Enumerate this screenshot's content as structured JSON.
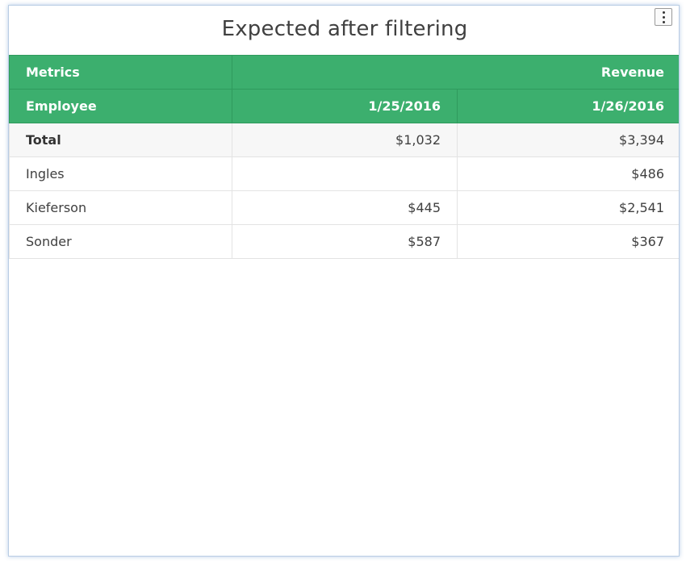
{
  "widget": {
    "title": "Expected after filtering",
    "menu_icon": "vertical-ellipsis-icon"
  },
  "table": {
    "header_row_1": {
      "metrics_label": "Metrics",
      "revenue_label": "Revenue"
    },
    "header_row_2": {
      "employee_label": "Employee",
      "dates": [
        "1/25/2016",
        "1/26/2016"
      ]
    },
    "rows": [
      {
        "name": "Total",
        "values": [
          "$1,032",
          "$3,394"
        ]
      },
      {
        "name": "Ingles",
        "values": [
          "",
          "$486"
        ]
      },
      {
        "name": "Kieferson",
        "values": [
          "$445",
          "$2,541"
        ]
      },
      {
        "name": "Sonder",
        "values": [
          "$587",
          "$367"
        ]
      }
    ]
  },
  "colors": {
    "header_green": "#3caf6e",
    "widget_border": "#b9cde4"
  }
}
